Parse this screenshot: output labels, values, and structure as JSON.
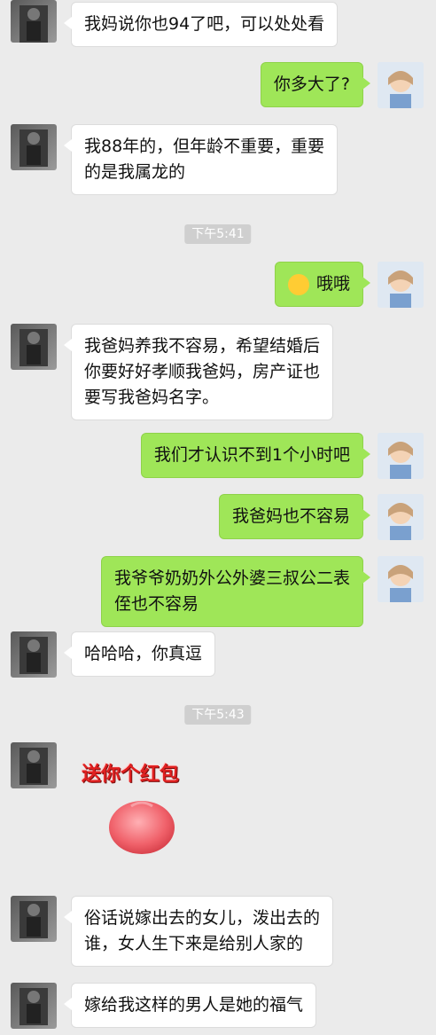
{
  "messages": [
    {
      "side": "left",
      "text": "我妈说你也94了吧，可以处处看"
    },
    {
      "side": "right",
      "text": "你多大了?"
    },
    {
      "side": "left",
      "text": "我88年的，但年龄不重要，重要\n的是我属龙的"
    },
    {
      "time": "下午5:41"
    },
    {
      "side": "right",
      "emoji": "surprised-face",
      "text": "哦哦"
    },
    {
      "side": "left",
      "text": "我爸妈养我不容易，希望结婚后\n你要好好孝顺我爸妈，房产证也\n要写我爸妈名字。"
    },
    {
      "side": "right",
      "text": "我们才认识不到1个小时吧"
    },
    {
      "side": "right",
      "text": "我爸妈也不容易"
    },
    {
      "side": "right",
      "text": "我爷爷奶奶外公外婆三叔公二表\n侄也不容易"
    },
    {
      "side": "left",
      "text": "哈哈哈，你真逗"
    },
    {
      "time": "下午5:43"
    },
    {
      "side": "left",
      "sticker": "送你个红包",
      "sticker_icon": "red-bun"
    },
    {
      "side": "left",
      "text": "俗话说嫁出去的女儿，泼出去的\n谁，女人生下来是给别人家的"
    },
    {
      "side": "left",
      "text": "嫁给我这样的男人是她的福气"
    }
  ]
}
